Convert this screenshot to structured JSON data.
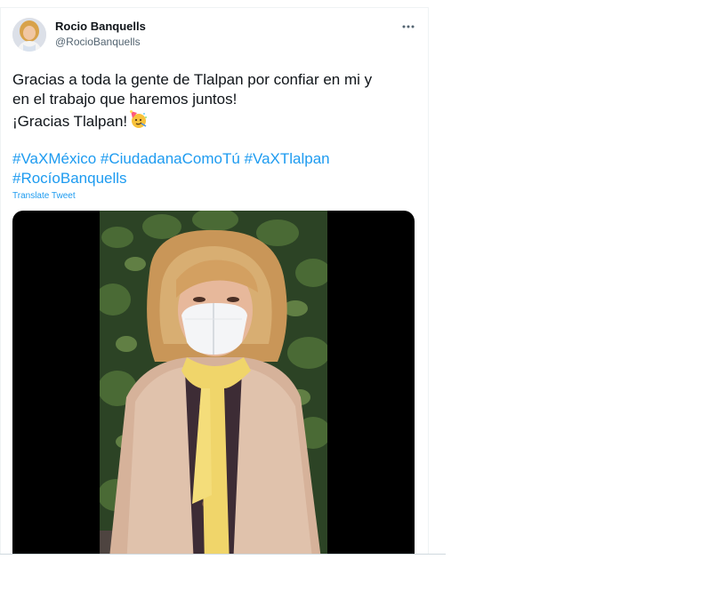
{
  "tweet": {
    "author": {
      "name": "Rocio Banquells",
      "handle": "@RocioBanquells"
    },
    "text_lines": [
      "Gracias a toda la gente de Tlalpan por confiar en mi y",
      "en el trabajo que haremos juntos!",
      "¡Gracias Tlalpan!"
    ],
    "hashtags": [
      "#VaXMéxico",
      "#CiudadanaComoTú",
      "#VaXTlalpan",
      "#RocíoBanquells"
    ],
    "translate_label": "Translate Tweet",
    "emoji": "party-face-emoji",
    "more_icon": "more-horizontal-icon"
  },
  "colors": {
    "link": "#1d9bf0",
    "text": "#0f1419",
    "muted": "#536471"
  }
}
